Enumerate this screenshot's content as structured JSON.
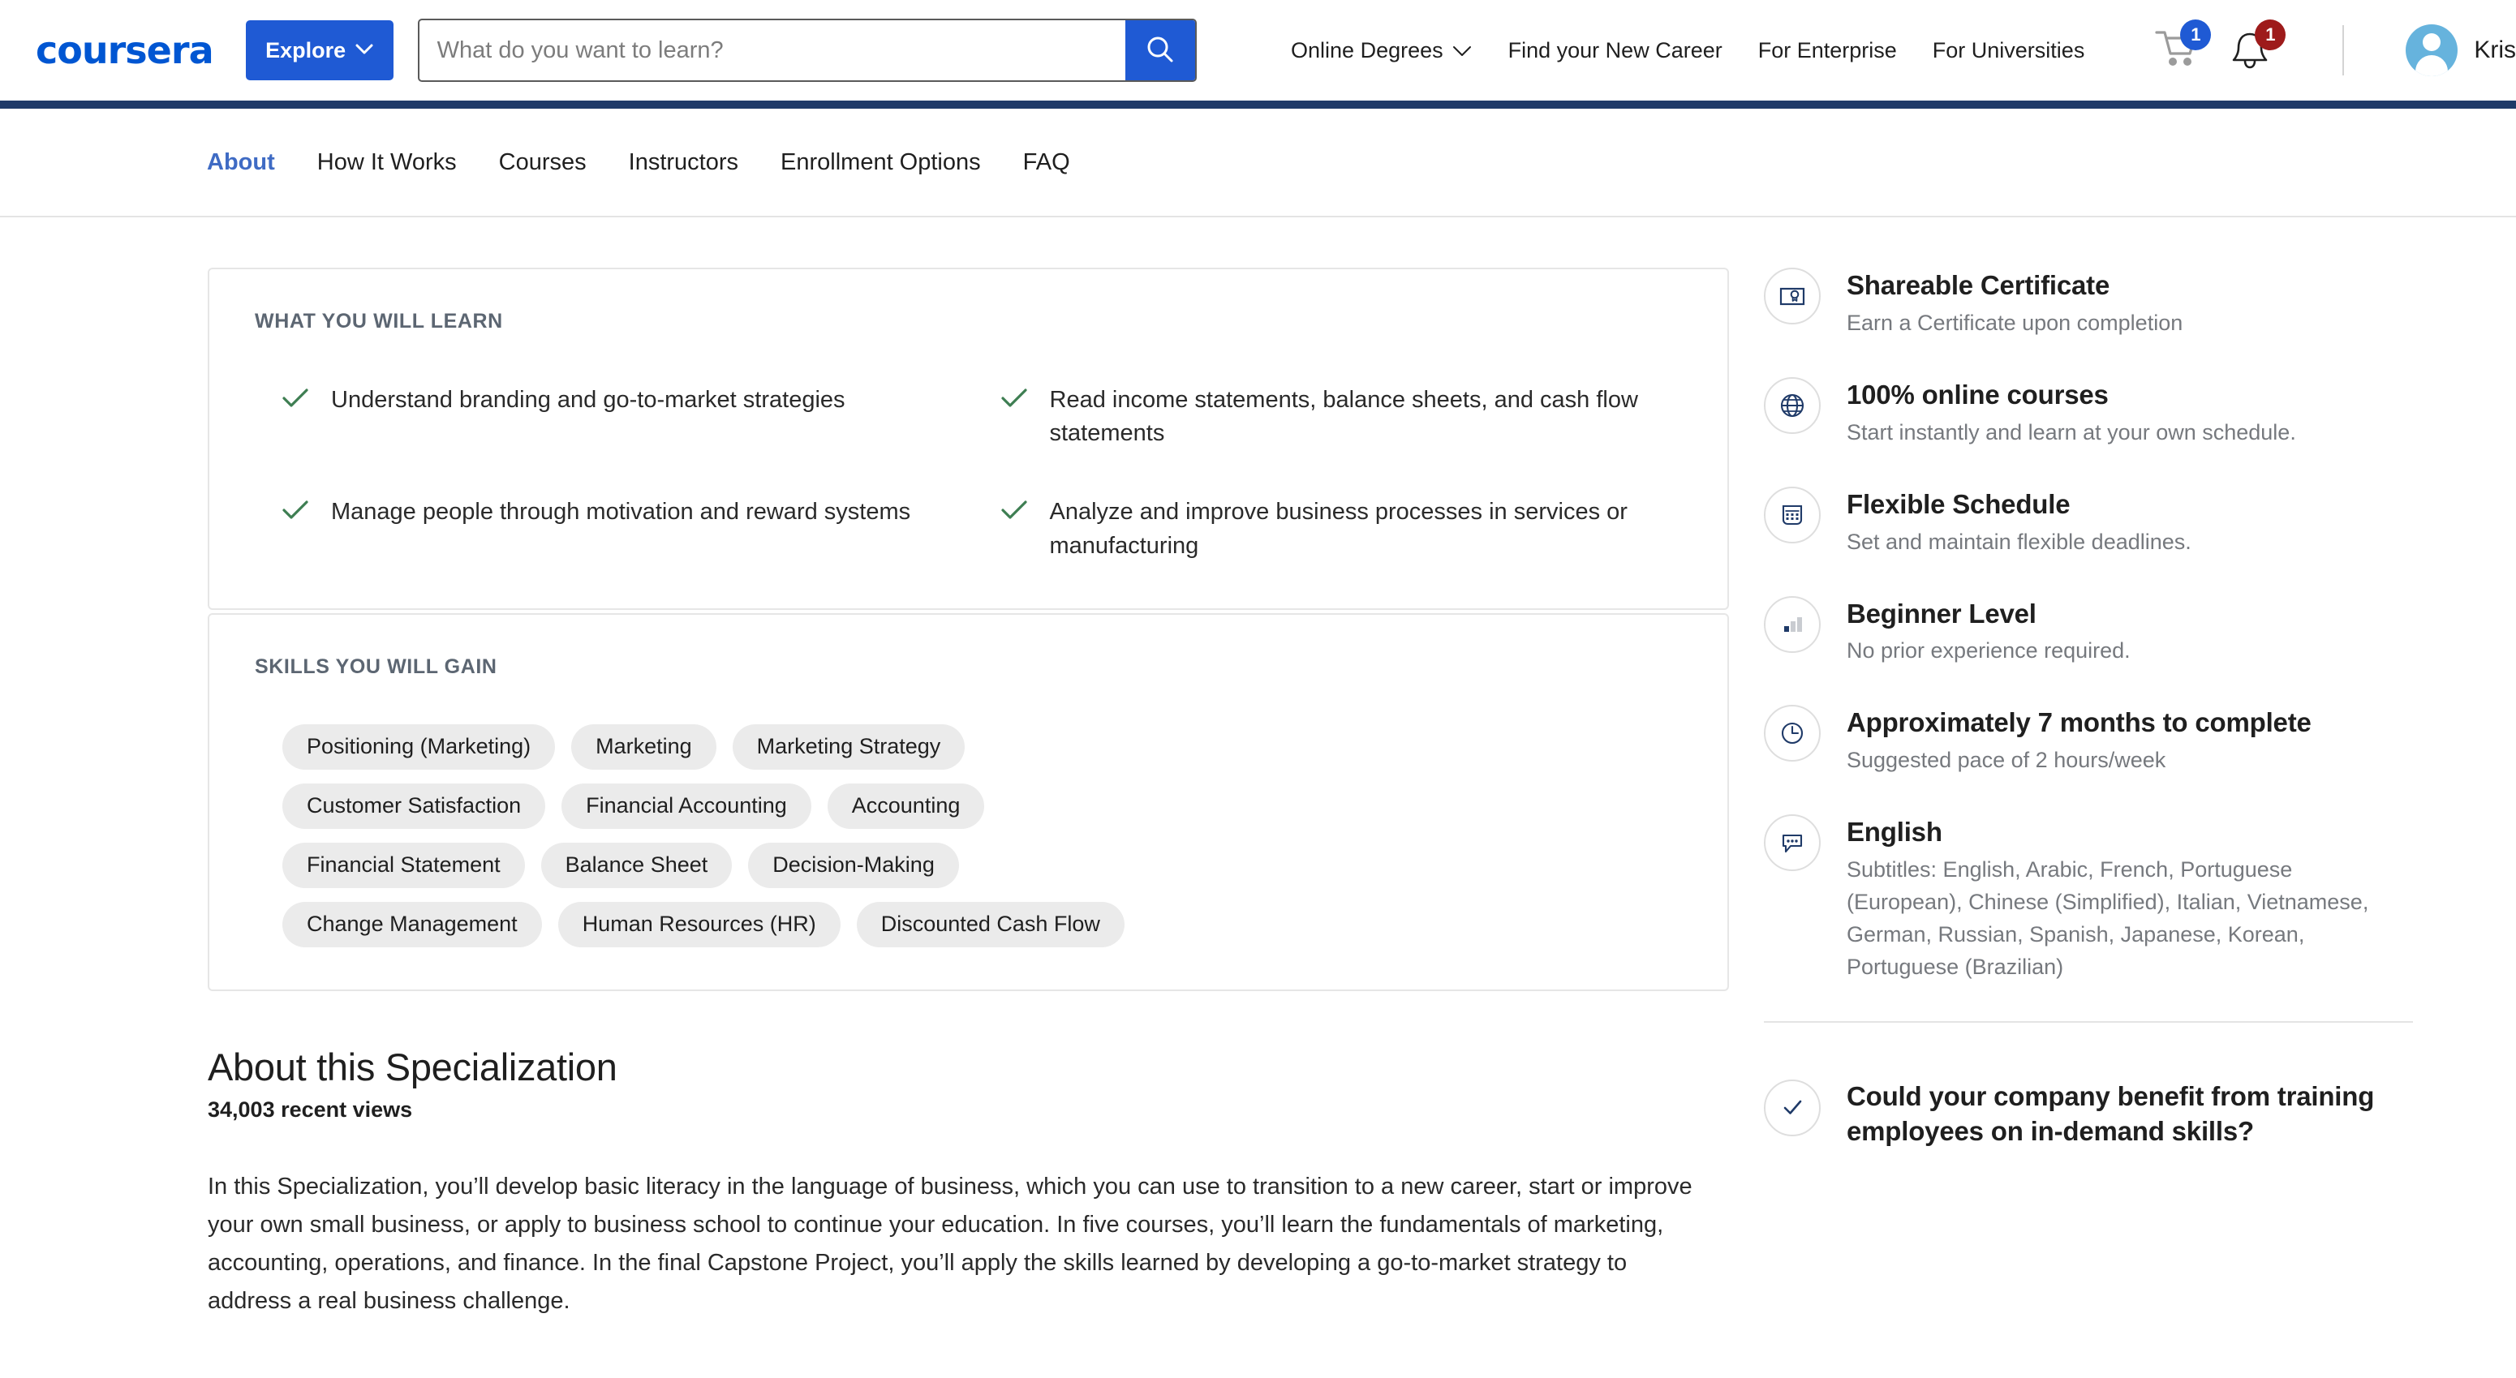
{
  "brand": {
    "logo_text": "coursera",
    "accent": "#0056D2",
    "button_blue": "#1F5AD4",
    "navy": "#1F3A68",
    "check_green": "#3E7E52"
  },
  "header": {
    "explore_label": "Explore",
    "explore_chevron": "⌄",
    "search": {
      "placeholder": "What do you want to learn?",
      "value": ""
    },
    "nav": [
      {
        "label": "Online Degrees",
        "has_chevron": true
      },
      {
        "label": "Find your New Career",
        "has_chevron": false
      },
      {
        "label": "For Enterprise",
        "has_chevron": false
      },
      {
        "label": "For Universities",
        "has_chevron": false
      }
    ],
    "cart_badge": "1",
    "notification_badge": "1",
    "account_name": "Kris"
  },
  "tabs": [
    {
      "label": "About",
      "active": true
    },
    {
      "label": "How It Works",
      "active": false
    },
    {
      "label": "Courses",
      "active": false
    },
    {
      "label": "Instructors",
      "active": false
    },
    {
      "label": "Enrollment Options",
      "active": false
    },
    {
      "label": "FAQ",
      "active": false
    }
  ],
  "what_you_will_learn": {
    "title": "WHAT YOU WILL LEARN",
    "items": [
      "Understand branding and go-to-market strategies",
      "Read income statements, balance sheets, and cash flow statements",
      "Manage people through motivation and reward systems",
      "Analyze and improve business processes in services or manufacturing"
    ]
  },
  "skills": {
    "title": "SKILLS YOU WILL GAIN",
    "chips": [
      "Positioning (Marketing)",
      "Marketing",
      "Marketing Strategy",
      "Customer Satisfaction",
      "Financial Accounting",
      "Accounting",
      "Financial Statement",
      "Balance Sheet",
      "Decision-Making",
      "Change Management",
      "Human Resources (HR)",
      "Discounted Cash Flow"
    ]
  },
  "about": {
    "heading": "About this Specialization",
    "views": "34,003 recent views",
    "description": "In this Specialization, you’ll develop basic literacy in the language of business, which you can use to transition to a new career, start or improve your own small business, or apply to business school to continue your education. In five courses, you’ll learn the fundamentals of marketing, accounting, operations, and finance. In the final Capstone Project, you’ll apply the skills learned by developing a go-to-market strategy to address a real business challenge."
  },
  "sidebar": {
    "features": [
      {
        "icon": "certificate-icon",
        "title": "Shareable Certificate",
        "subtitle": "Earn a Certificate upon completion"
      },
      {
        "icon": "globe-icon",
        "title": "100% online courses",
        "subtitle": "Start instantly and learn at your own schedule."
      },
      {
        "icon": "calendar-icon",
        "title": "Flexible Schedule",
        "subtitle": "Set and maintain flexible deadlines."
      },
      {
        "icon": "bar-chart-icon",
        "title": "Beginner Level",
        "subtitle": "No prior experience required."
      },
      {
        "icon": "clock-icon",
        "title": "Approximately 7 months to complete",
        "subtitle": "Suggested pace of 2 hours/week"
      },
      {
        "icon": "speech-bubble-icon",
        "title": "English",
        "subtitle": "Subtitles: English, Arabic, French, Portuguese (European), Chinese (Simplified), Italian, Vietnamese, German, Russian, Spanish, Japanese, Korean, Portuguese (Brazilian)"
      }
    ],
    "promo": {
      "icon": "check-circle-icon",
      "title": "Could your company benefit from training employees on in-demand skills?"
    }
  }
}
